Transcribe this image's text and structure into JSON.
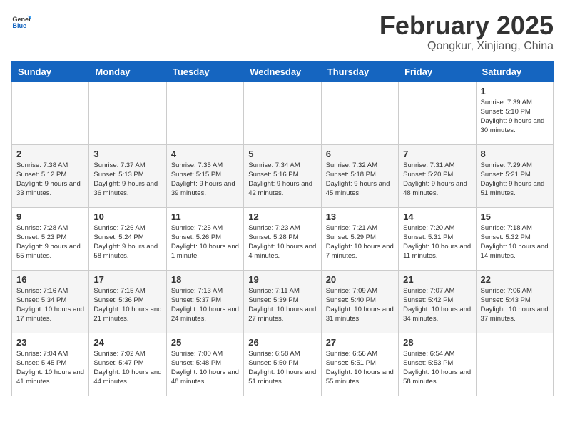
{
  "header": {
    "logo_general": "General",
    "logo_blue": "Blue",
    "month_title": "February 2025",
    "location": "Qongkur, Xinjiang, China"
  },
  "calendar": {
    "days_of_week": [
      "Sunday",
      "Monday",
      "Tuesday",
      "Wednesday",
      "Thursday",
      "Friday",
      "Saturday"
    ],
    "weeks": [
      [
        {
          "day": "",
          "info": ""
        },
        {
          "day": "",
          "info": ""
        },
        {
          "day": "",
          "info": ""
        },
        {
          "day": "",
          "info": ""
        },
        {
          "day": "",
          "info": ""
        },
        {
          "day": "",
          "info": ""
        },
        {
          "day": "1",
          "info": "Sunrise: 7:39 AM\nSunset: 5:10 PM\nDaylight: 9 hours and 30 minutes."
        }
      ],
      [
        {
          "day": "2",
          "info": "Sunrise: 7:38 AM\nSunset: 5:12 PM\nDaylight: 9 hours and 33 minutes."
        },
        {
          "day": "3",
          "info": "Sunrise: 7:37 AM\nSunset: 5:13 PM\nDaylight: 9 hours and 36 minutes."
        },
        {
          "day": "4",
          "info": "Sunrise: 7:35 AM\nSunset: 5:15 PM\nDaylight: 9 hours and 39 minutes."
        },
        {
          "day": "5",
          "info": "Sunrise: 7:34 AM\nSunset: 5:16 PM\nDaylight: 9 hours and 42 minutes."
        },
        {
          "day": "6",
          "info": "Sunrise: 7:32 AM\nSunset: 5:18 PM\nDaylight: 9 hours and 45 minutes."
        },
        {
          "day": "7",
          "info": "Sunrise: 7:31 AM\nSunset: 5:20 PM\nDaylight: 9 hours and 48 minutes."
        },
        {
          "day": "8",
          "info": "Sunrise: 7:29 AM\nSunset: 5:21 PM\nDaylight: 9 hours and 51 minutes."
        }
      ],
      [
        {
          "day": "9",
          "info": "Sunrise: 7:28 AM\nSunset: 5:23 PM\nDaylight: 9 hours and 55 minutes."
        },
        {
          "day": "10",
          "info": "Sunrise: 7:26 AM\nSunset: 5:24 PM\nDaylight: 9 hours and 58 minutes."
        },
        {
          "day": "11",
          "info": "Sunrise: 7:25 AM\nSunset: 5:26 PM\nDaylight: 10 hours and 1 minute."
        },
        {
          "day": "12",
          "info": "Sunrise: 7:23 AM\nSunset: 5:28 PM\nDaylight: 10 hours and 4 minutes."
        },
        {
          "day": "13",
          "info": "Sunrise: 7:21 AM\nSunset: 5:29 PM\nDaylight: 10 hours and 7 minutes."
        },
        {
          "day": "14",
          "info": "Sunrise: 7:20 AM\nSunset: 5:31 PM\nDaylight: 10 hours and 11 minutes."
        },
        {
          "day": "15",
          "info": "Sunrise: 7:18 AM\nSunset: 5:32 PM\nDaylight: 10 hours and 14 minutes."
        }
      ],
      [
        {
          "day": "16",
          "info": "Sunrise: 7:16 AM\nSunset: 5:34 PM\nDaylight: 10 hours and 17 minutes."
        },
        {
          "day": "17",
          "info": "Sunrise: 7:15 AM\nSunset: 5:36 PM\nDaylight: 10 hours and 21 minutes."
        },
        {
          "day": "18",
          "info": "Sunrise: 7:13 AM\nSunset: 5:37 PM\nDaylight: 10 hours and 24 minutes."
        },
        {
          "day": "19",
          "info": "Sunrise: 7:11 AM\nSunset: 5:39 PM\nDaylight: 10 hours and 27 minutes."
        },
        {
          "day": "20",
          "info": "Sunrise: 7:09 AM\nSunset: 5:40 PM\nDaylight: 10 hours and 31 minutes."
        },
        {
          "day": "21",
          "info": "Sunrise: 7:07 AM\nSunset: 5:42 PM\nDaylight: 10 hours and 34 minutes."
        },
        {
          "day": "22",
          "info": "Sunrise: 7:06 AM\nSunset: 5:43 PM\nDaylight: 10 hours and 37 minutes."
        }
      ],
      [
        {
          "day": "23",
          "info": "Sunrise: 7:04 AM\nSunset: 5:45 PM\nDaylight: 10 hours and 41 minutes."
        },
        {
          "day": "24",
          "info": "Sunrise: 7:02 AM\nSunset: 5:47 PM\nDaylight: 10 hours and 44 minutes."
        },
        {
          "day": "25",
          "info": "Sunrise: 7:00 AM\nSunset: 5:48 PM\nDaylight: 10 hours and 48 minutes."
        },
        {
          "day": "26",
          "info": "Sunrise: 6:58 AM\nSunset: 5:50 PM\nDaylight: 10 hours and 51 minutes."
        },
        {
          "day": "27",
          "info": "Sunrise: 6:56 AM\nSunset: 5:51 PM\nDaylight: 10 hours and 55 minutes."
        },
        {
          "day": "28",
          "info": "Sunrise: 6:54 AM\nSunset: 5:53 PM\nDaylight: 10 hours and 58 minutes."
        },
        {
          "day": "",
          "info": ""
        }
      ]
    ]
  }
}
